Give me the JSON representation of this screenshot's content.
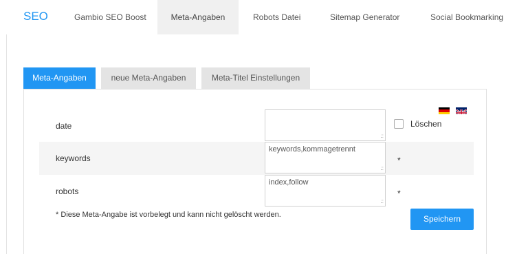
{
  "topnav": {
    "brand": "SEO",
    "tabs": [
      {
        "label": "Gambio SEO Boost"
      },
      {
        "label": "Meta-Angaben"
      },
      {
        "label": "Robots Datei"
      },
      {
        "label": "Sitemap Generator"
      },
      {
        "label": "Social Bookmarking"
      }
    ],
    "active_tab": "Meta-Angaben"
  },
  "subtabs": [
    {
      "label": "Meta-Angaben"
    },
    {
      "label": "neue Meta-Angaben"
    },
    {
      "label": "Meta-Titel Einstellungen"
    }
  ],
  "active_subtab": "Meta-Angaben",
  "languages": [
    {
      "icon": "flag-germany-icon"
    },
    {
      "icon": "flag-uk-icon"
    }
  ],
  "meta_rows": [
    {
      "label": "date",
      "value": "",
      "required_marker": ""
    },
    {
      "label": "keywords",
      "value": "keywords,kommagetrennt",
      "required_marker": "*"
    },
    {
      "label": "robots",
      "value": "index,follow",
      "required_marker": "*"
    }
  ],
  "delete_label": "Löschen",
  "delete_checked": false,
  "note": "* Diese Meta-Angabe ist vorbelegt und kann nicht gelöscht werden.",
  "save_label": "Speichern",
  "colors": {
    "accent": "#2196f3",
    "tab_inactive": "#e4e4e4",
    "row_stripe": "#f5f5f5"
  }
}
